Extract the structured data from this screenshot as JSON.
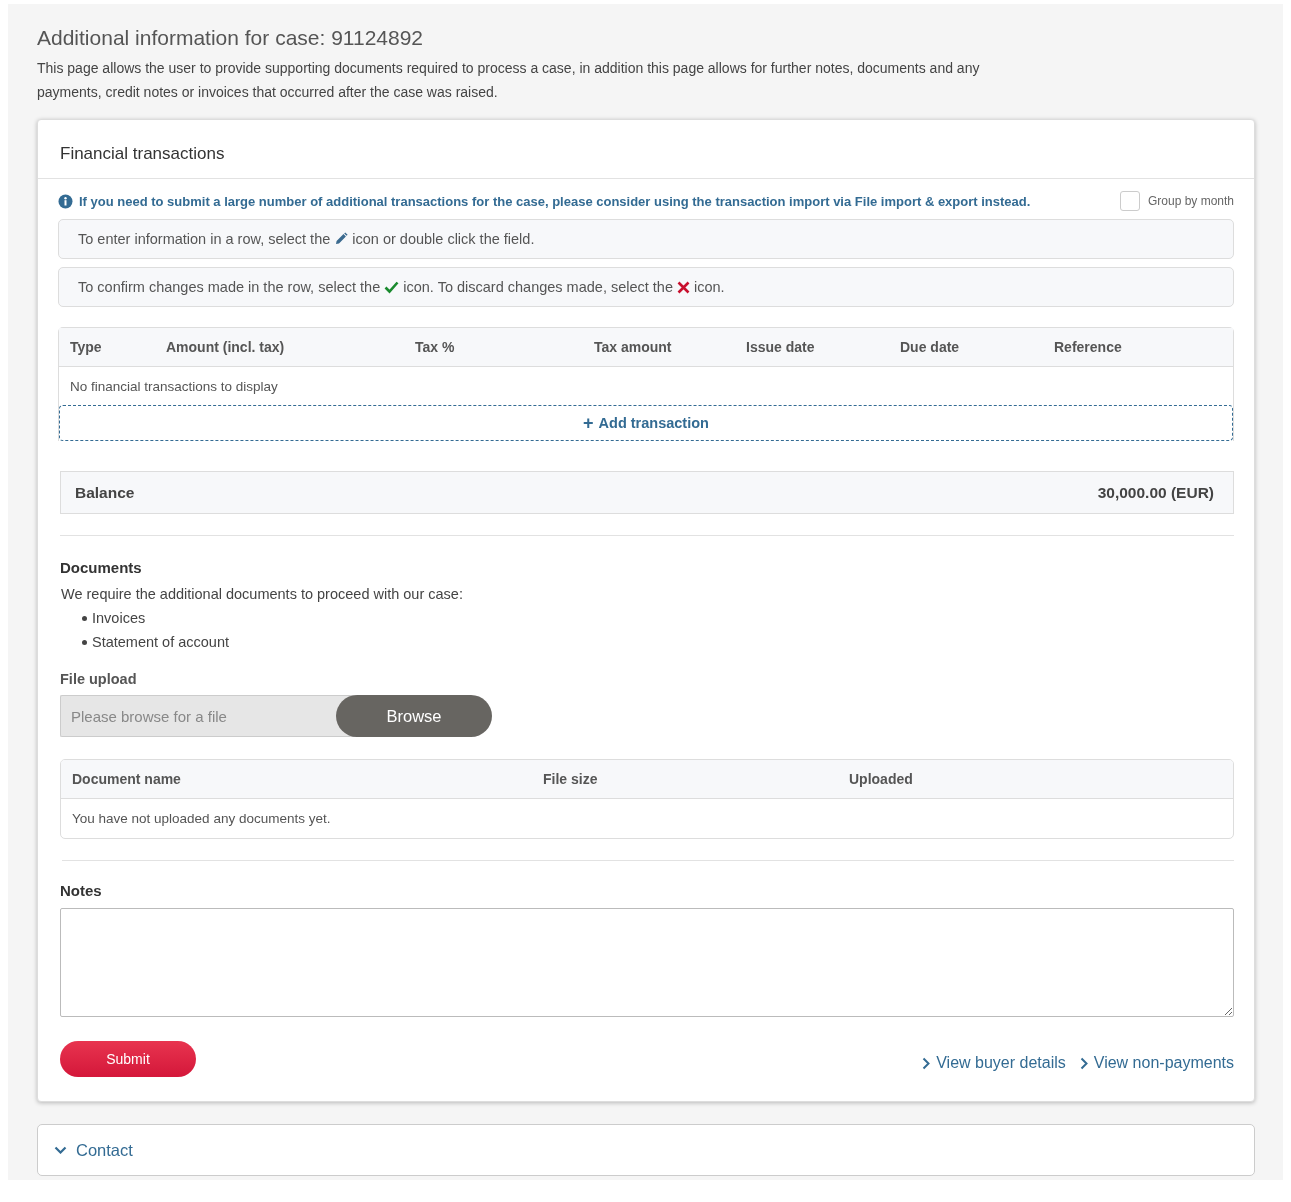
{
  "page": {
    "title": "Additional information for case: 91124892",
    "description": "This page allows the user to provide supporting documents required to process a case, in addition this page allows for further notes, documents and any payments, credit notes or invoices that occurred after the case was raised."
  },
  "financial_transactions": {
    "title": "Financial transactions",
    "info_notice": "If you need to submit a large number of additional transactions for the case, please consider using the transaction import via File import & export instead.",
    "group_by_month": {
      "label": "Group by month",
      "checked": false
    },
    "hints": [
      [
        {
          "kind": "text",
          "text": "To enter information in a row, select the"
        },
        {
          "kind": "pencil"
        },
        {
          "kind": "text",
          "text": "icon or double click the field."
        }
      ],
      [
        {
          "kind": "text",
          "text": "To confirm changes made in the row, select the"
        },
        {
          "kind": "check"
        },
        {
          "kind": "text",
          "text": "icon. To discard changes made, select the"
        },
        {
          "kind": "cross"
        },
        {
          "kind": "text",
          "text": "icon."
        }
      ]
    ],
    "table": {
      "columns": [
        "Type",
        "Amount (incl. tax)",
        "Tax %",
        "Tax amount",
        "Issue date",
        "Due date",
        "Reference"
      ],
      "empty_message": "No financial transactions to display"
    },
    "add_transaction": {
      "icon": "+",
      "label": "Add transaction"
    },
    "balance": {
      "label": "Balance",
      "value": "30,000.00 (EUR)"
    }
  },
  "documents": {
    "title": "Documents",
    "intro": "We require the additional documents to proceed with our case:",
    "required": [
      "Invoices",
      "Statement of account"
    ],
    "file_upload": {
      "label": "File upload",
      "placeholder": "Please browse for a file",
      "button": "Browse"
    },
    "table": {
      "columns": [
        "Document name",
        "File size",
        "Uploaded"
      ],
      "empty_message": "You have not uploaded any documents yet."
    }
  },
  "notes": {
    "title": "Notes"
  },
  "submit": "Submit",
  "links": [
    "View buyer details",
    "View non-payments"
  ],
  "contact": {
    "title": "Contact",
    "expanded": false
  }
}
